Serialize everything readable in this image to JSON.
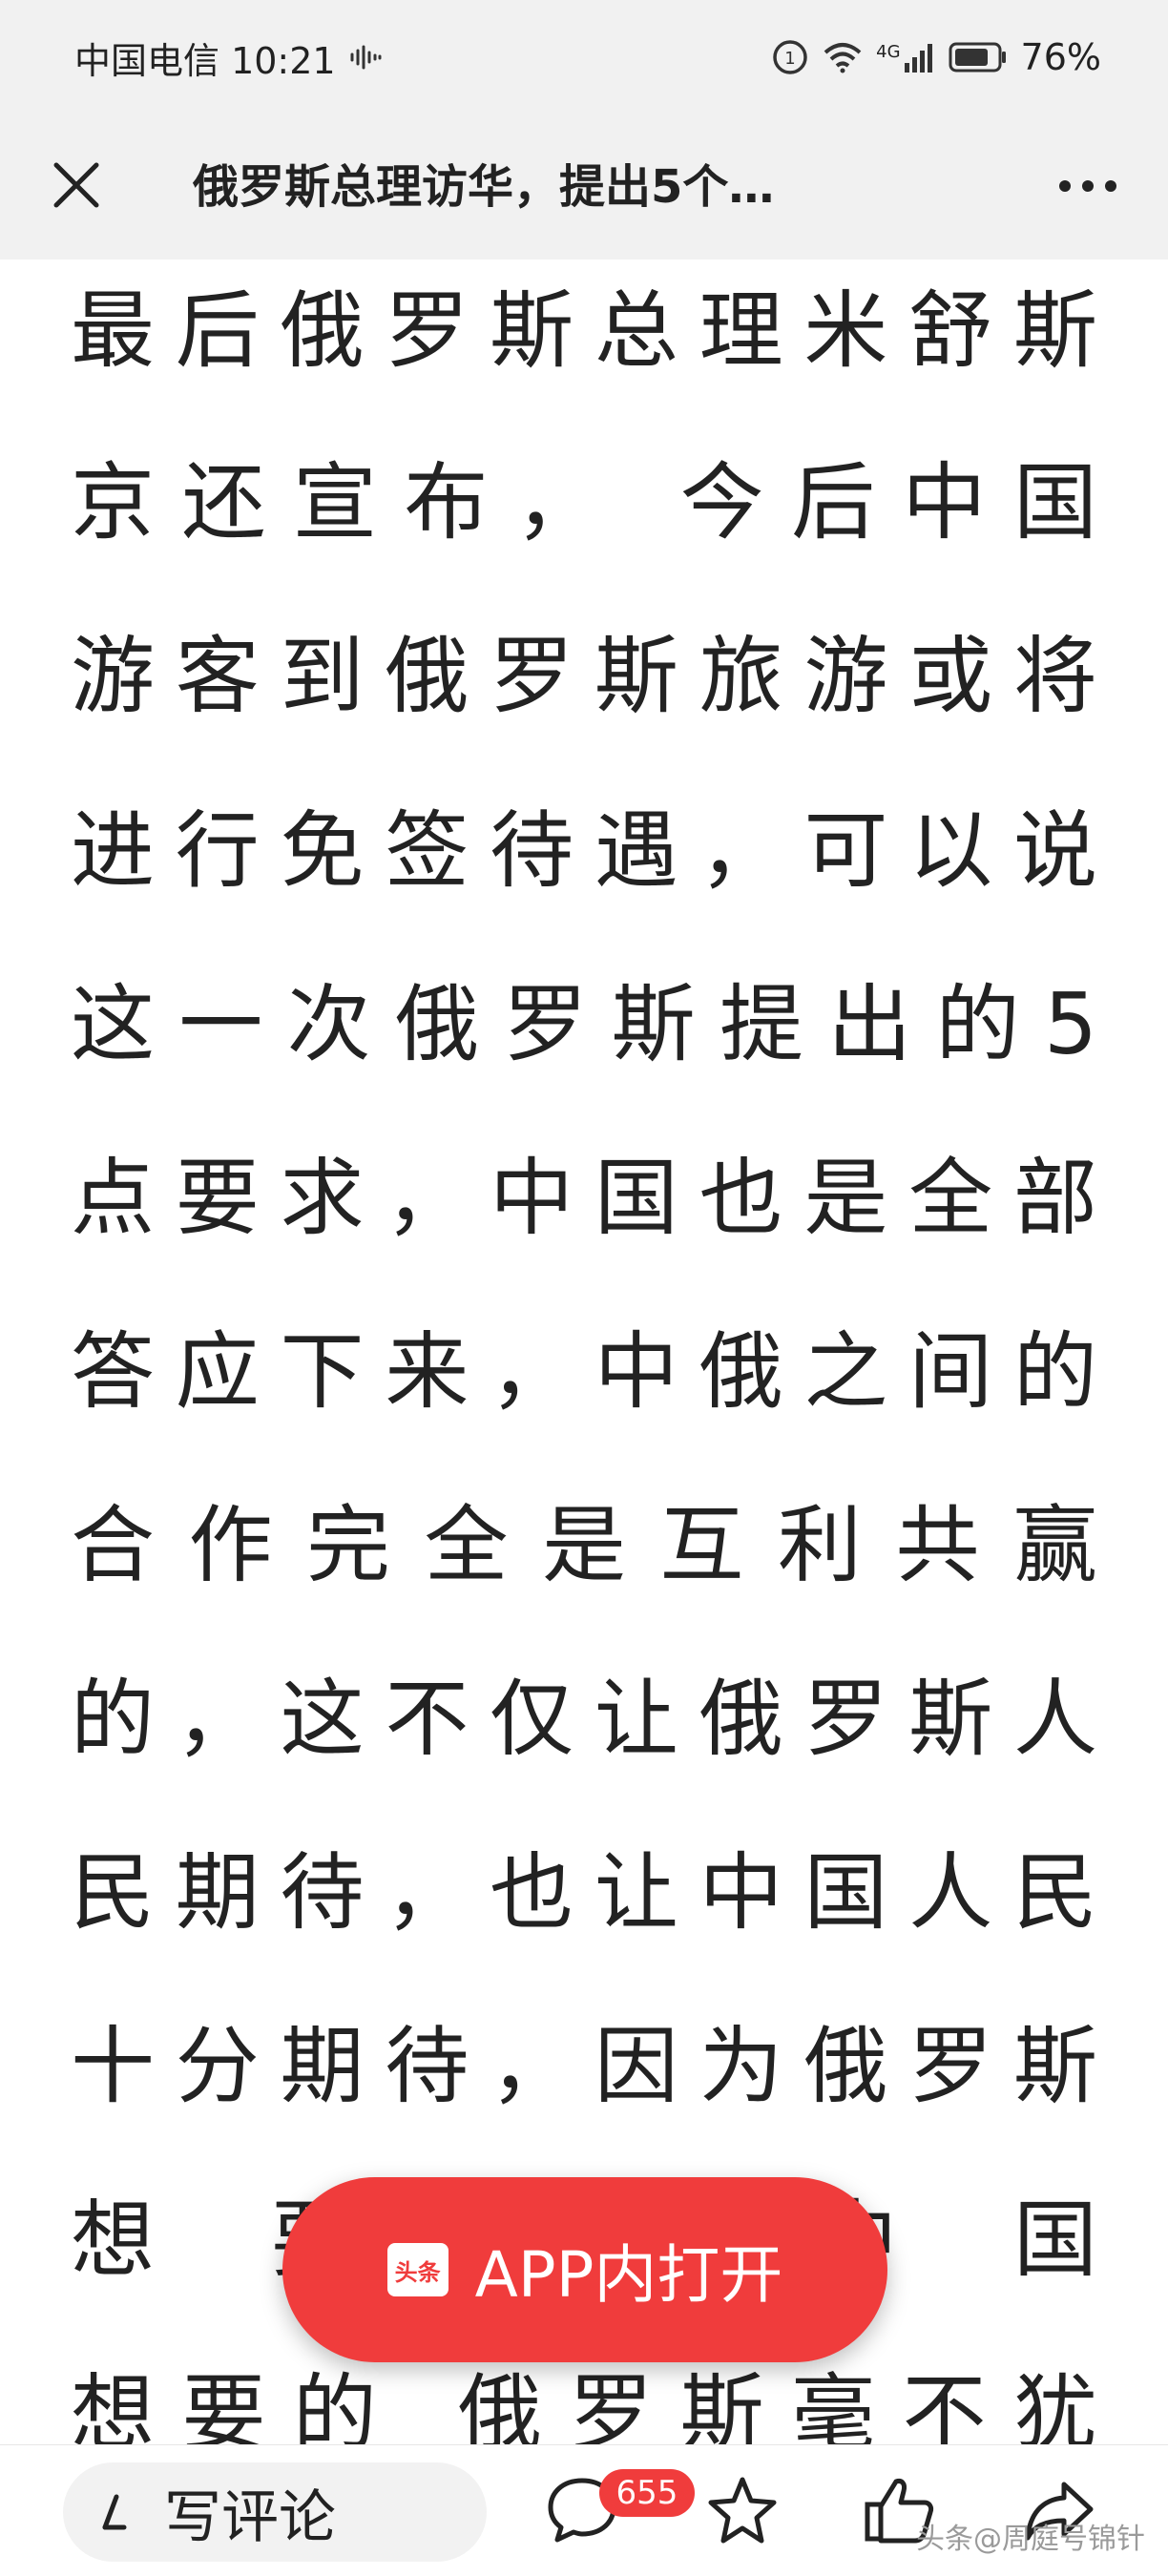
{
  "status_bar": {
    "carrier_time": "中国电信 10:21",
    "network": "4G",
    "battery": "76%"
  },
  "header": {
    "title": "俄罗斯总理访华，提出5个…"
  },
  "article": {
    "lines": [
      "最后俄罗斯总理米舒斯",
      "京还宣布， 今后中国",
      "游客到俄罗斯旅游或将",
      "进行免签待遇，可以说",
      "这一次俄罗斯提出的5",
      "点要求，中国也是全部",
      "答应下来，中俄之间的",
      "合作完全是互利共赢",
      "的，这不仅让俄罗斯人",
      "民期待，也让中国人民",
      "十分期待，因为俄罗斯",
      "想要的 中国",
      "想要的 俄罗斯毫不犹"
    ]
  },
  "open_app": {
    "logo_text": "头条",
    "label": "APP内打开"
  },
  "bottom_bar": {
    "comment_placeholder": "写评论",
    "comment_count": "655",
    "watermark": "头条@周庭号锦针"
  },
  "colors": {
    "accent": "#f03c3c",
    "header_bg": "#f1f1f1",
    "text": "#222222"
  },
  "icons": [
    "waveform-icon",
    "data-saver-icon",
    "wifi-icon",
    "signal-icon",
    "battery-icon",
    "close-icon",
    "more-icon",
    "pen-icon",
    "comment-icon",
    "star-icon",
    "thumbs-up-icon",
    "share-icon"
  ]
}
